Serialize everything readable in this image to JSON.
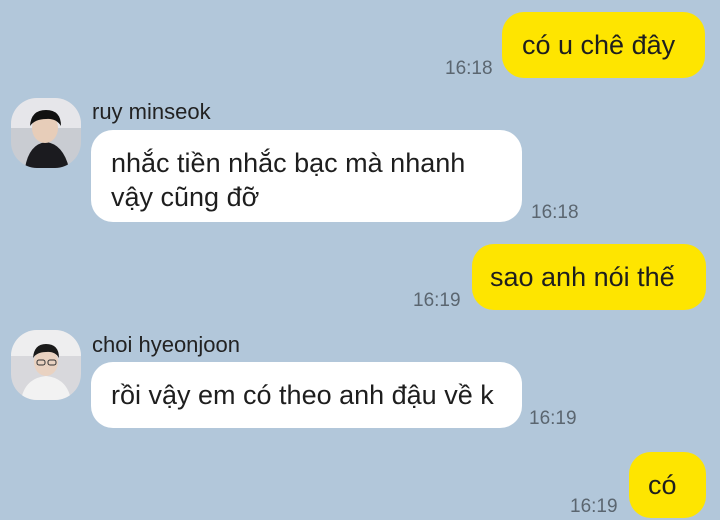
{
  "messages": [
    {
      "direction": "out",
      "text": "có u chê đây",
      "time": "16:18"
    },
    {
      "direction": "in",
      "sender": "ruy minseok",
      "avatar": "profile-photo",
      "text_lines": [
        "nhắc tiền nhắc bạc mà nhanh",
        "vậy cũng đỡ"
      ],
      "time": "16:18"
    },
    {
      "direction": "out",
      "text": "sao anh nói thế",
      "time": "16:19"
    },
    {
      "direction": "in",
      "sender": "choi hyeonjoon",
      "avatar": "profile-photo",
      "text": "rồi vậy em có theo anh đậu về k",
      "time": "16:19"
    },
    {
      "direction": "out",
      "text": "có",
      "time": "16:19"
    }
  ]
}
